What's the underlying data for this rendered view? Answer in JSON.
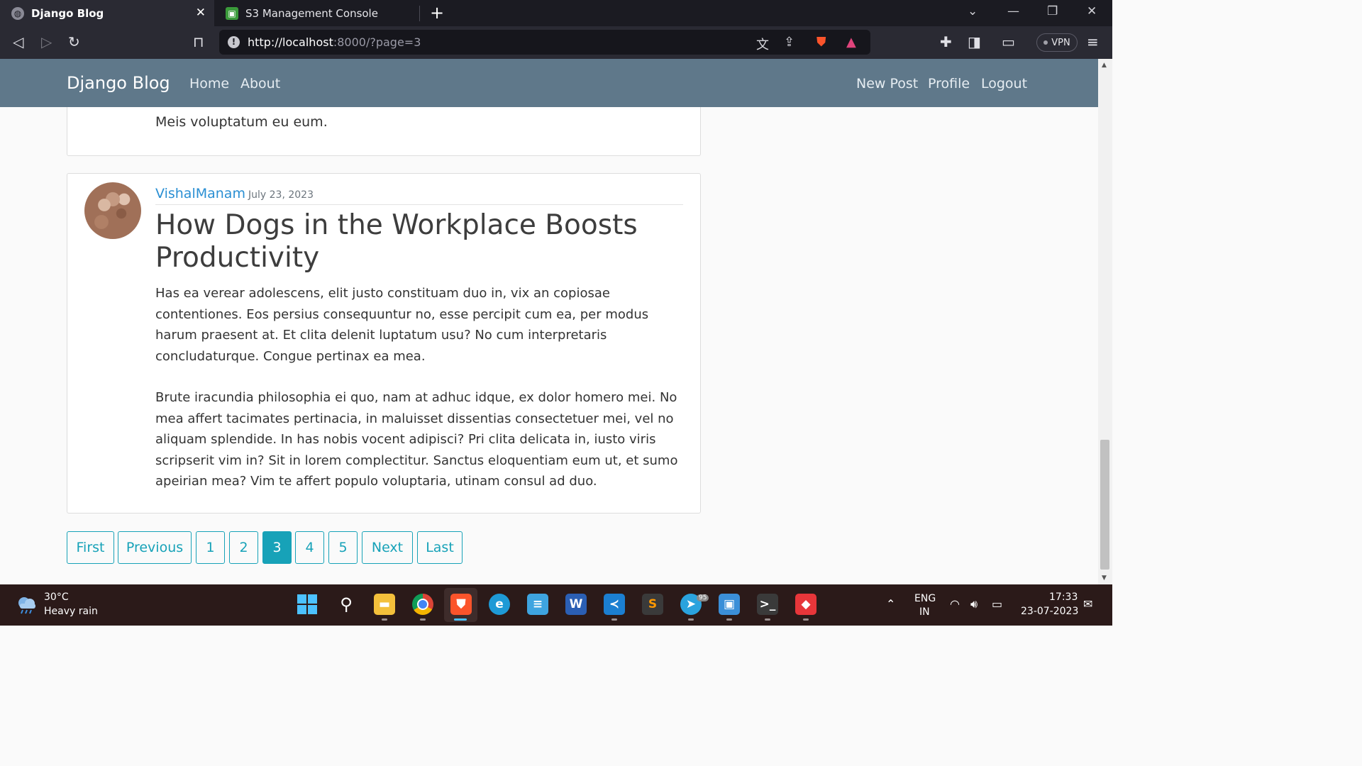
{
  "browser": {
    "tabs": [
      {
        "title": "Django Blog",
        "active": true
      },
      {
        "title": "S3 Management Console",
        "active": false
      }
    ],
    "url_host": "http://localhost",
    "url_rest": ":8000/?page=3",
    "vpn_label": "VPN"
  },
  "navbar": {
    "brand": "Django Blog",
    "left_links": [
      "Home",
      "About"
    ],
    "right_links": [
      "New Post",
      "Profile",
      "Logout"
    ]
  },
  "posts": [
    {
      "partial_text": "Meis voluptatum eu eum."
    },
    {
      "author": "VishalManam",
      "date": "July 23, 2023",
      "title": "How Dogs in the Workplace Boosts Productivity",
      "paragraphs": [
        "Has ea verear adolescens, elit justo constituam duo in, vix an copiosae contentiones. Eos persius consequuntur no, esse percipit cum ea, per modus harum praesent at. Et clita delenit luptatum usu? No cum interpretaris concludaturque. Congue pertinax ea mea.",
        "Brute iracundia philosophia ei quo, nam at adhuc idque, ex dolor homero mei. No mea affert tacimates pertinacia, in maluisset dissentias consectetuer mei, vel no aliquam splendide. In has nobis vocent adipisci? Pri clita delicata in, iusto viris scripserit vim in? Sit in lorem complectitur. Sanctus eloquentiam eum ut, et sumo apeirian mea? Vim te affert populo voluptaria, utinam consul ad duo."
      ]
    }
  ],
  "pagination": {
    "first": "First",
    "previous": "Previous",
    "pages": [
      "1",
      "2",
      "3",
      "4",
      "5"
    ],
    "current": "3",
    "next": "Next",
    "last": "Last"
  },
  "taskbar": {
    "weather_temp": "30°C",
    "weather_desc": "Heavy rain",
    "telegram_badge": "95",
    "lang_top": "ENG",
    "lang_bottom": "IN",
    "time": "17:33",
    "date": "23-07-2023"
  },
  "colors": {
    "navbar": "#5f788a",
    "link": "#2a8fd3",
    "pager_accent": "#17a2b8"
  }
}
